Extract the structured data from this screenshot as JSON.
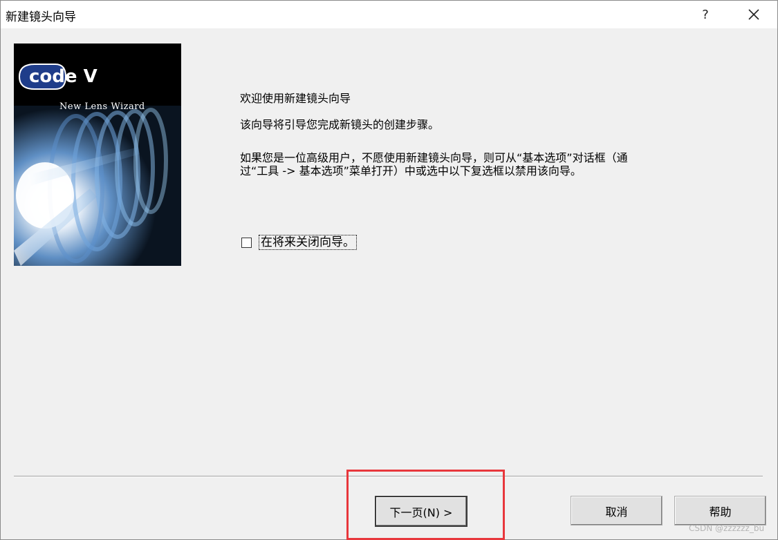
{
  "window": {
    "title": "新建镜头向导",
    "help_glyph": "?",
    "close_glyph": "close-icon"
  },
  "banner": {
    "logo_text": "code V",
    "subtitle": "New Lens Wizard"
  },
  "content": {
    "welcome": "欢迎使用新建镜头向导",
    "intro": "该向导将引导您完成新镜头的创建步骤。",
    "advanced_line1": "如果您是一位高级用户，不愿使用新建镜头向导，则可从“基本选项”对话框（通",
    "advanced_line2": "过“工具 -> 基本选项”菜单打开）中或选中以下复选框以禁用该向导。"
  },
  "checkbox": {
    "label": "在将来关闭向导。",
    "checked": false
  },
  "buttons": {
    "next": "下一页(N) >",
    "cancel": "取消",
    "help": "帮助"
  },
  "watermark": "CSDN @zzzzzz_bu",
  "colors": {
    "highlight": "#e8373c",
    "dialog_bg": "#f0f0f0"
  }
}
